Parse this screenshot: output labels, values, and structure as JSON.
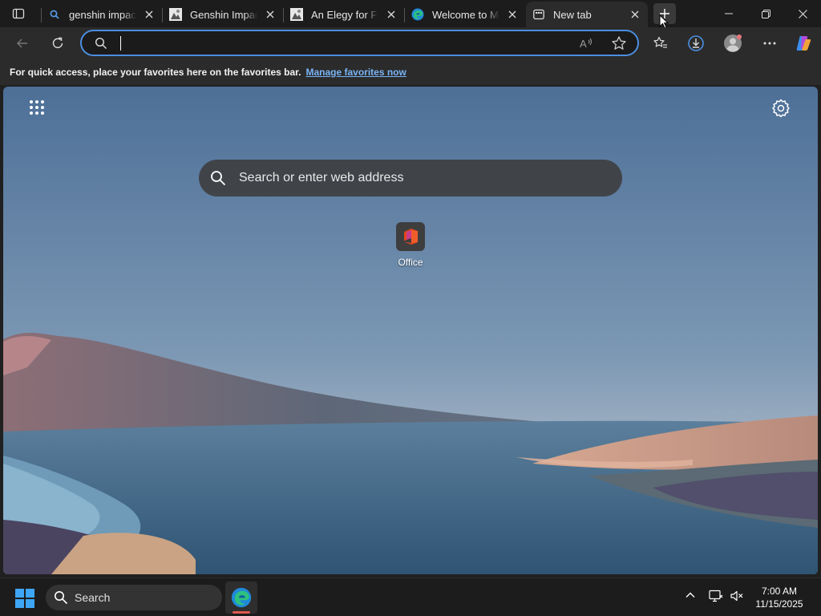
{
  "tabs": [
    {
      "title": "genshin impact - Search",
      "favicon": "search-icon"
    },
    {
      "title": "Genshin Impact - Wikipedia",
      "favicon": "image-favicon"
    },
    {
      "title": "An Elegy for Faded Time",
      "favicon": "image-favicon"
    },
    {
      "title": "Welcome to Microsoft Edge",
      "favicon": "edge-icon"
    },
    {
      "title": "New tab",
      "favicon": "newtab-icon",
      "active": true
    }
  ],
  "address_bar": {
    "value": "",
    "placeholder": ""
  },
  "favorites_bar": {
    "message": "For quick access, place your favorites here on the favorites bar.",
    "link": "Manage favorites now"
  },
  "newtab": {
    "search_placeholder": "Search or enter web address",
    "tiles": [
      {
        "label": "Office",
        "icon": "office-icon"
      }
    ]
  },
  "taskbar": {
    "search_placeholder": "Search",
    "time": "7:00 AM",
    "date": "11/15/2025"
  },
  "colors": {
    "accent": "#4c8ee0",
    "link": "#7ab4f5"
  }
}
